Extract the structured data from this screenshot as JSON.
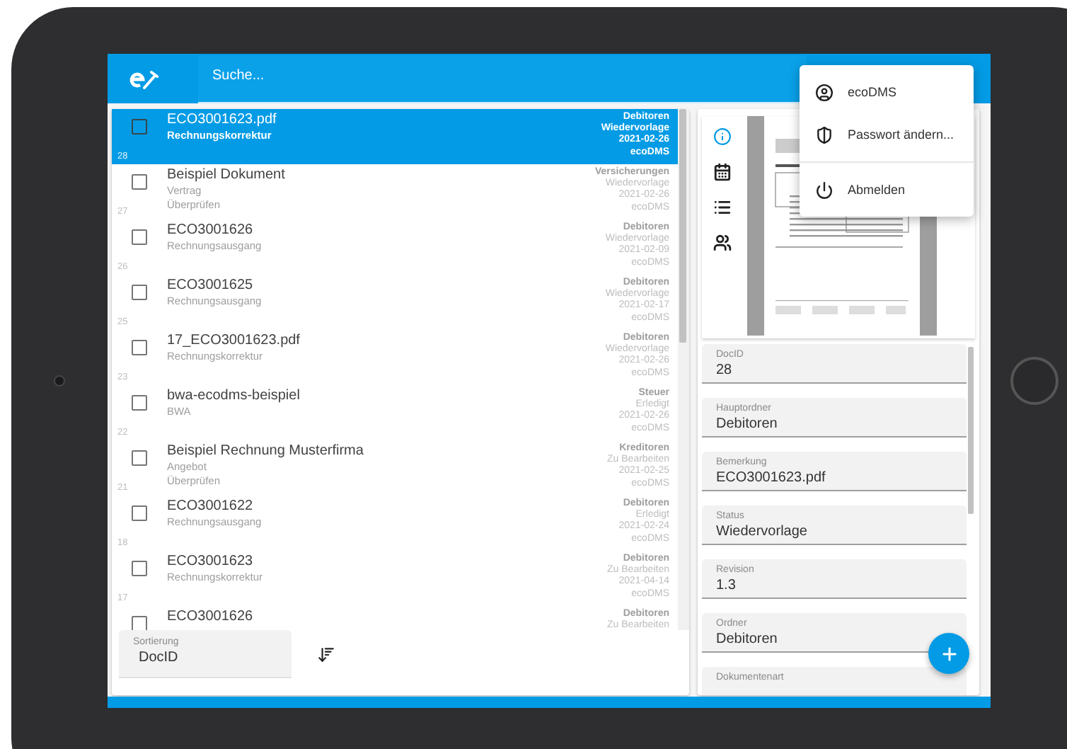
{
  "app_bar": {
    "search": {
      "placeholder": "Suche..."
    }
  },
  "documents": [
    {
      "title": "ECO3001623.pdf",
      "lines": [
        "Rechnungskorrektur"
      ],
      "doc_id": "28",
      "meta": [
        "Debitoren",
        "Wiedervorlage",
        "2021-02-26",
        "ecoDMS"
      ],
      "selected": true,
      "checked": false
    },
    {
      "title": "Beispiel Dokument",
      "lines": [
        "Vertrag",
        "Überprüfen"
      ],
      "doc_id": "27",
      "meta": [
        "Versicherungen",
        "Wiedervorlage",
        "2021-02-26",
        "ecoDMS"
      ],
      "selected": false,
      "checked": false
    },
    {
      "title": "ECO3001626",
      "lines": [
        "Rechnungsausgang"
      ],
      "doc_id": "26",
      "meta": [
        "Debitoren",
        "Wiedervorlage",
        "2021-02-09",
        "ecoDMS"
      ],
      "selected": false,
      "checked": false
    },
    {
      "title": "ECO3001625",
      "lines": [
        "Rechnungsausgang"
      ],
      "doc_id": "25",
      "meta": [
        "Debitoren",
        "Wiedervorlage",
        "2021-02-17",
        "ecoDMS"
      ],
      "selected": false,
      "checked": false
    },
    {
      "title": "17_ECO3001623.pdf",
      "lines": [
        "Rechnungskorrektur"
      ],
      "doc_id": "23",
      "meta": [
        "Debitoren",
        "Wiedervorlage",
        "2021-02-26",
        "ecoDMS"
      ],
      "selected": false,
      "checked": false
    },
    {
      "title": "bwa-ecodms-beispiel",
      "lines": [
        "BWA"
      ],
      "doc_id": "22",
      "meta": [
        "Steuer",
        "Erledigt",
        "2021-02-26",
        "ecoDMS"
      ],
      "selected": false,
      "checked": false
    },
    {
      "title": "Beispiel Rechnung Musterfirma",
      "lines": [
        "Angebot",
        "Überprüfen"
      ],
      "doc_id": "21",
      "meta": [
        "Kreditoren",
        "Zu Bearbeiten",
        "2021-02-25",
        "ecoDMS"
      ],
      "selected": false,
      "checked": false
    },
    {
      "title": "ECO3001622",
      "lines": [
        "Rechnungsausgang"
      ],
      "doc_id": "18",
      "meta": [
        "Debitoren",
        "Erledigt",
        "2021-02-24",
        "ecoDMS"
      ],
      "selected": false,
      "checked": false
    },
    {
      "title": "ECO3001623",
      "lines": [
        "Rechnungskorrektur"
      ],
      "doc_id": "17",
      "meta": [
        "Debitoren",
        "Zu Bearbeiten",
        "2021-04-14",
        "ecoDMS"
      ],
      "selected": false,
      "checked": false
    },
    {
      "title": "ECO3001626",
      "meta": [
        "Debitoren",
        "Zu Bearbeiten"
      ],
      "selected": false,
      "checked": false
    }
  ],
  "sort": {
    "label": "Sortierung",
    "value": "DocID"
  },
  "detail": {
    "tabs": [
      {
        "kind": "info",
        "selected": true
      },
      {
        "kind": "calendar",
        "selected": false
      },
      {
        "kind": "list",
        "selected": false
      },
      {
        "kind": "people",
        "selected": false
      }
    ],
    "fields": [
      {
        "label": "DocID",
        "value": "28"
      },
      {
        "label": "Hauptordner",
        "value": "Debitoren"
      },
      {
        "label": "Bemerkung",
        "value": "ECO3001623.pdf"
      },
      {
        "label": "Status",
        "value": "Wiedervorlage"
      },
      {
        "label": "Revision",
        "value": "1.3"
      },
      {
        "label": "Ordner",
        "value": "Debitoren"
      },
      {
        "label": "Dokumentenart"
      }
    ]
  },
  "user_menu": {
    "items": [
      {
        "kind": "user",
        "label": "ecoDMS"
      },
      {
        "kind": "password",
        "label": "Passwort ändern..."
      },
      {
        "kind": "logout",
        "label": "Abmelden"
      }
    ]
  }
}
